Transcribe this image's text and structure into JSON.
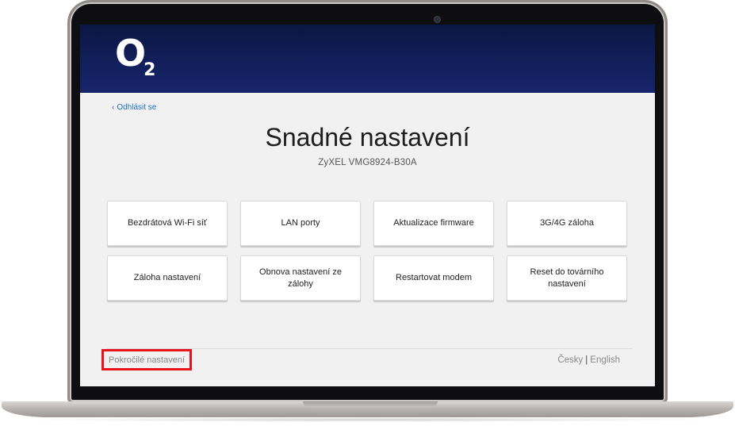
{
  "brand": {
    "logo_letter": "O",
    "logo_subscript": "2"
  },
  "nav": {
    "logout_chevron": "‹",
    "logout_label": "Odhlásit se"
  },
  "main": {
    "title": "Snadné nastavení",
    "device_model": "ZyXEL VMG8924-B30A",
    "tiles": [
      {
        "label": "Bezdrátová Wi-Fi síť"
      },
      {
        "label": "LAN porty"
      },
      {
        "label": "Aktualizace firmware"
      },
      {
        "label": "3G/4G záloha"
      },
      {
        "label": "Záloha nastavení"
      },
      {
        "label": "Obnova nastavení ze zálohy"
      },
      {
        "label": "Restartovat modem"
      },
      {
        "label": "Reset do továrního nastavení"
      }
    ]
  },
  "footer": {
    "advanced_label": "Pokročilé nastavení",
    "lang_czech": "Česky",
    "lang_separator": "|",
    "lang_english": "English"
  },
  "colors": {
    "header_navy": "#121f5b",
    "link_blue": "#1f6fc7",
    "highlight_red": "#e8141b"
  }
}
